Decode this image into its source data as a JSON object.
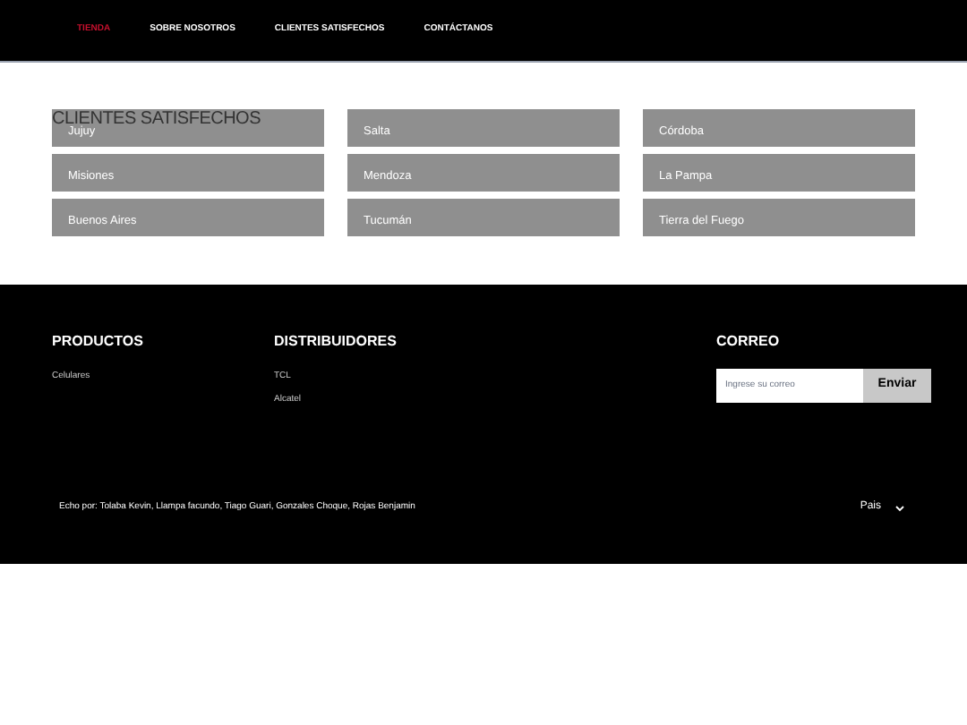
{
  "nav": [
    {
      "label": "TIENDA",
      "selected": true
    },
    {
      "label": "SOBRE NOSOTROS",
      "selected": false
    },
    {
      "label": "CLIENTES SATISFECHOS",
      "selected": false
    },
    {
      "label": "CONTÁCTANOS",
      "selected": false
    }
  ],
  "clients": {
    "title": "CLIENTES SATISFECHOS",
    "items": [
      "Jujuy",
      "Salta",
      "Córdoba",
      "Misiones",
      "Mendoza",
      "La Pampa",
      "Buenos Aires",
      "Tucumán",
      "Tierra del Fuego"
    ]
  },
  "footer": {
    "columns": [
      {
        "title": "PRODUCTOS",
        "links": [
          "Celulares"
        ]
      },
      {
        "title": "DISTRIBUIDORES",
        "links": [
          "TCL",
          "Alcatel"
        ]
      }
    ],
    "newsletter": {
      "title": "CORREO",
      "placeholder": "Ingrese su correo",
      "button": "Enviar"
    },
    "credits": "Echo por: Tolaba Kevin, Llampa facundo, Tiago Guari, Gonzales Choque, Rojas Benjamin",
    "country": "Pais"
  }
}
